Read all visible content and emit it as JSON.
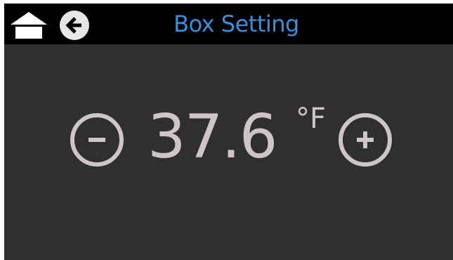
{
  "header": {
    "title": "Box Setting"
  },
  "setpoint": {
    "value": "37.6",
    "unit": "°F"
  },
  "icons": {
    "home": "home-icon",
    "back": "arrow-left-circle-icon",
    "decrease": "minus-circle-icon",
    "increase": "plus-circle-icon"
  },
  "colors": {
    "title": "#3a8fd8",
    "value": "#cfc4c8",
    "background": "#2f2f2f",
    "header_background": "#000000"
  }
}
